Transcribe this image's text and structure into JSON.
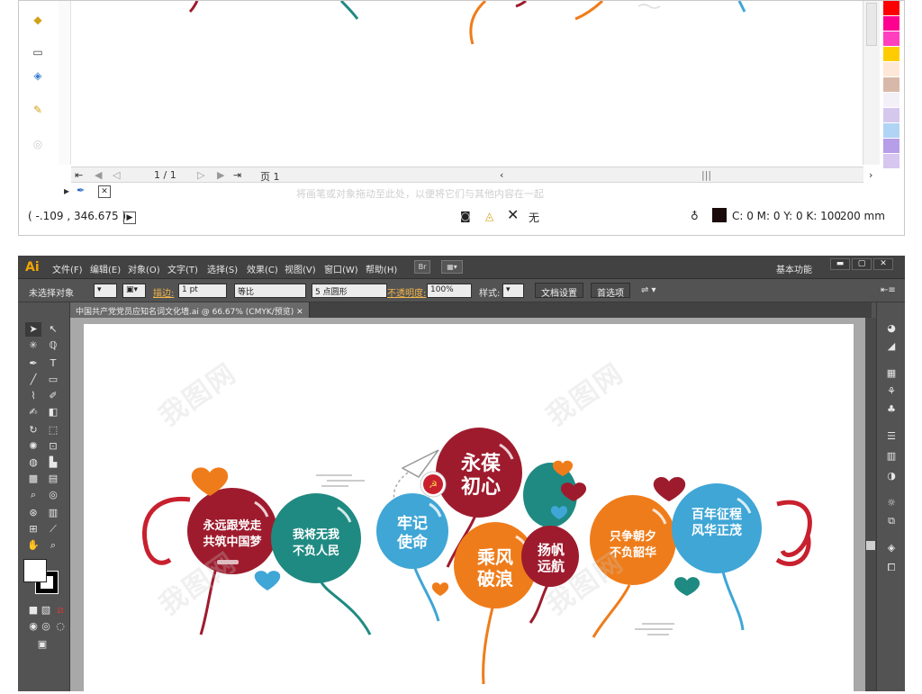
{
  "top_window": {
    "page_indicator": "1 / 1",
    "page_label": "页 1",
    "hint_text": "将画笔或对象拖动至此处，以便将它们与其他内容在一起",
    "coordinates": "( -.109 , 346.675 )",
    "no_fill_label": "无",
    "color_info": "C: 0 M: 0 Y: 0 K: 100",
    "stroke_width": ".200 mm",
    "swatches": [
      "#ff0000",
      "#ff0090",
      "#ff3fc0",
      "#ffcc00",
      "#fde8d8",
      "#d8b8a8",
      "#f4f0f8",
      "#d6c8ec",
      "#b0d4f4",
      "#b79ee8",
      "#d6c6f0"
    ]
  },
  "illustrator": {
    "logo": "Ai",
    "menu": [
      "文件(F)",
      "编辑(E)",
      "对象(O)",
      "文字(T)",
      "选择(S)",
      "效果(C)",
      "视图(V)",
      "窗口(W)",
      "帮助(H)"
    ],
    "bridge_label": "Br",
    "workspace": "基本功能",
    "control_bar": {
      "selection_status": "未选择对象",
      "stroke_label": "描边:",
      "stroke_value": "1 pt",
      "profile_label": "等比",
      "brush_label": "5 点圆形",
      "opacity_label": "不透明度:",
      "opacity_value": "100%",
      "style_label": "样式:",
      "doc_setup_button": "文档设置",
      "prefs_button": "首选项"
    },
    "document_tab": "中国共产党党员应知名词文化墙.ai @ 66.67% (CMYK/预览)"
  },
  "artwork": {
    "balloons": [
      {
        "text": [
          "永远跟党走",
          "共筑中国梦"
        ],
        "color": "#9e1b2d"
      },
      {
        "text": [
          "我将无我",
          "不负人民"
        ],
        "color": "#1f8a82"
      },
      {
        "text": [
          "牢记",
          "使命"
        ],
        "color": "#3fa6d6"
      },
      {
        "text": [
          "永葆",
          "初心"
        ],
        "color": "#9e1b2d"
      },
      {
        "text": [
          "乘风",
          "破浪"
        ],
        "color": "#ef7c1a"
      },
      {
        "text": [
          "扬帆",
          "远航"
        ],
        "color": "#9e1b2d"
      },
      {
        "text": [
          "只争朝夕",
          "不负韶华"
        ],
        "color": "#ef7c1a"
      },
      {
        "text": [
          "百年征程",
          "风华正茂"
        ],
        "color": "#3fa6d6"
      }
    ],
    "heart_colors": {
      "orange": "#ef7c1a",
      "red": "#9e1b2d",
      "blue": "#3fa6d6",
      "teal": "#1f8a82"
    }
  },
  "watermark": "我图网"
}
